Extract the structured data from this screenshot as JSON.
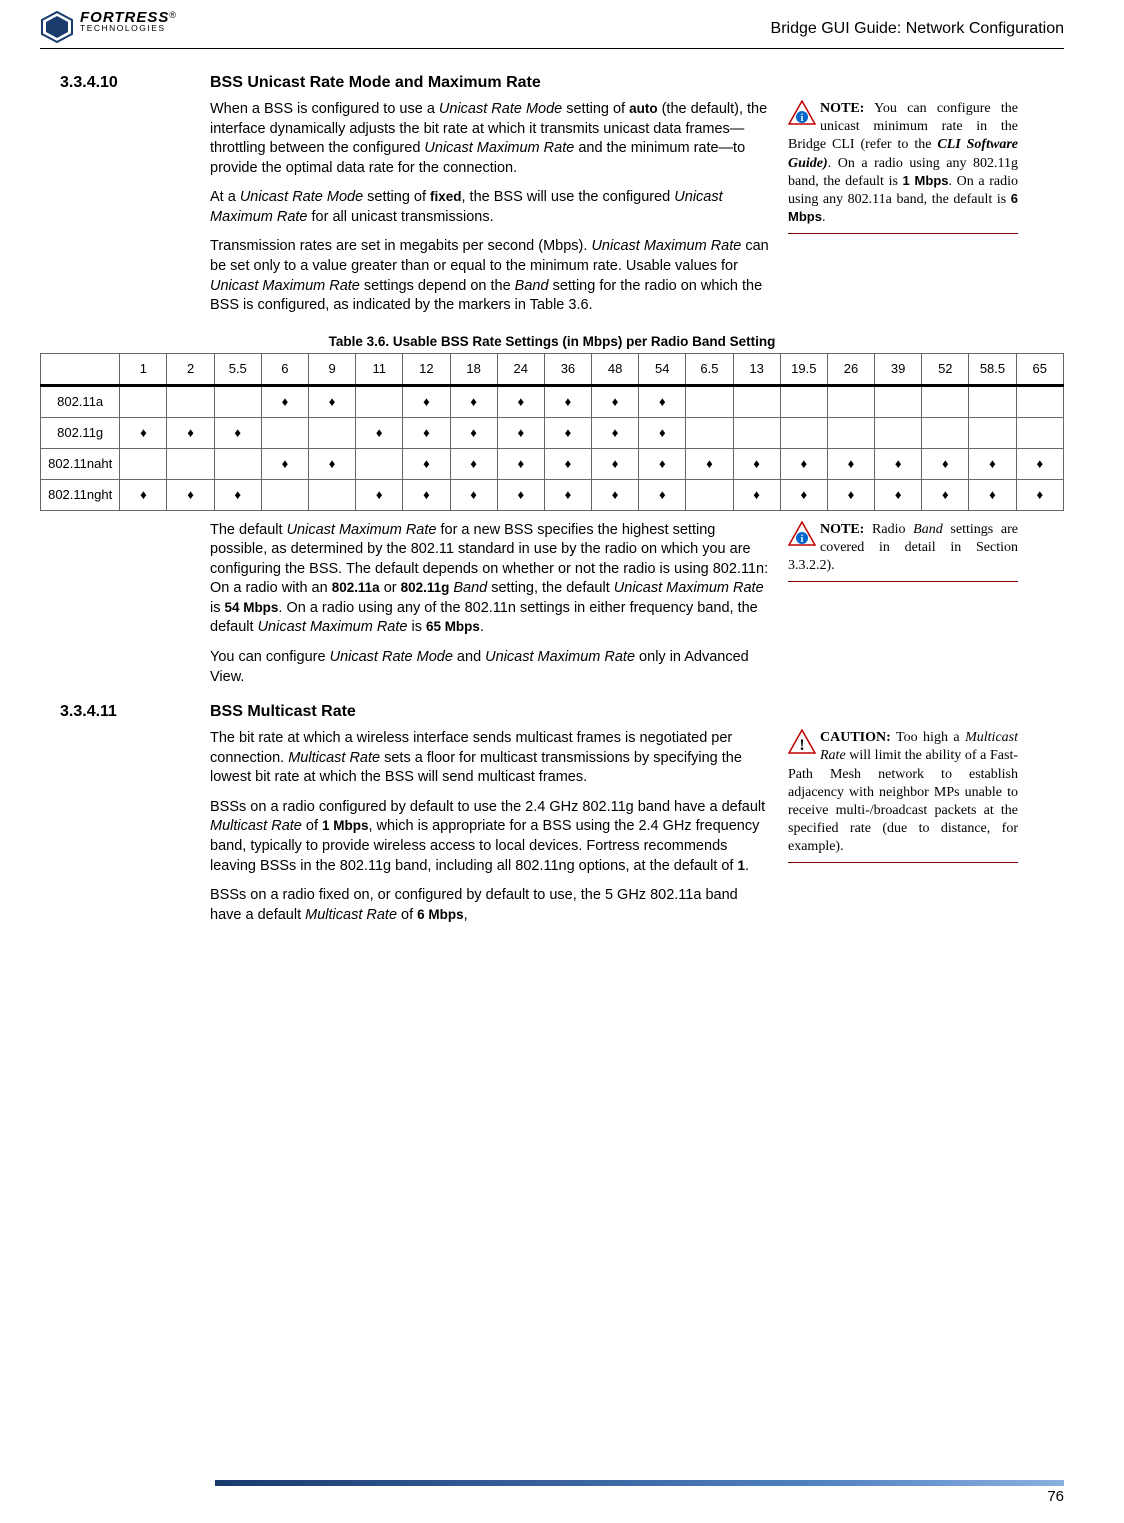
{
  "header": {
    "logo_brand": "FORTRESS",
    "logo_sub": "TECHNOLOGIES",
    "logo_r": "®",
    "guide_title": "Bridge GUI Guide: Network Configuration"
  },
  "sec10": {
    "num": "3.3.4.10",
    "heading": "BSS Unicast Rate Mode and Maximum Rate",
    "p1_a": "When a BSS is configured to use a ",
    "p1_b": "Unicast Rate Mode",
    "p1_c": " setting of ",
    "p1_d": "auto",
    "p1_e": " (the default), the interface dynamically adjusts the bit rate at which it transmits unicast data frames—throttling between the configured ",
    "p1_f": "Unicast Maximum Rate",
    "p1_g": " and the minimum rate—to provide the optimal data rate for the connection.",
    "p2_a": "At a ",
    "p2_b": "Unicast Rate Mode",
    "p2_c": " setting of ",
    "p2_d": "fixed",
    "p2_e": ", the BSS will use the configured ",
    "p2_f": "Unicast Maximum Rate",
    "p2_g": " for all unicast transmissions.",
    "p3_a": "Transmission rates are set in megabits per second (Mbps). ",
    "p3_b": "Unicast Maximum Rate",
    "p3_c": " can be set only to a value greater than or equal to the minimum rate. Usable values for ",
    "p3_d": "Unicast Maximum Rate",
    "p3_e": " settings depend on the ",
    "p3_f": "Band",
    "p3_g": " setting for the radio on which the BSS is configured, as indicated by the markers in Table 3.6.",
    "note_label": "NOTE:",
    "note_a": " You can configure the unicast minimum rate in the Bridge CLI (refer to the ",
    "note_b": "CLI Software Guide)",
    "note_c": ". On a radio using any 802.11g band, the default is ",
    "note_d": "1 Mbps",
    "note_e": ". On a radio using any 802.11a band, the default is ",
    "note_f": "6 Mbps",
    "note_g": "."
  },
  "table": {
    "caption": "Table 3.6. Usable BSS Rate Settings (in Mbps) per Radio Band Setting",
    "headers": [
      "",
      "1",
      "2",
      "5.5",
      "6",
      "9",
      "11",
      "12",
      "18",
      "24",
      "36",
      "48",
      "54",
      "6.5",
      "13",
      "19.5",
      "26",
      "39",
      "52",
      "58.5",
      "65"
    ],
    "rows": [
      {
        "band": "802.11a",
        "marks": [
          0,
          0,
          0,
          1,
          1,
          0,
          1,
          1,
          1,
          1,
          1,
          1,
          0,
          0,
          0,
          0,
          0,
          0,
          0,
          0
        ]
      },
      {
        "band": "802.11g",
        "marks": [
          1,
          1,
          1,
          0,
          0,
          1,
          1,
          1,
          1,
          1,
          1,
          1,
          0,
          0,
          0,
          0,
          0,
          0,
          0,
          0
        ]
      },
      {
        "band": "802.11naht",
        "marks": [
          0,
          0,
          0,
          1,
          1,
          0,
          1,
          1,
          1,
          1,
          1,
          1,
          1,
          1,
          1,
          1,
          1,
          1,
          1,
          1
        ]
      },
      {
        "band": "802.11nght",
        "marks": [
          1,
          1,
          1,
          0,
          0,
          1,
          1,
          1,
          1,
          1,
          1,
          1,
          0,
          1,
          1,
          1,
          1,
          1,
          1,
          1
        ]
      }
    ]
  },
  "after_table": {
    "p1_a": "The default ",
    "p1_b": "Unicast Maximum Rate",
    "p1_c": " for a new BSS specifies the highest setting possible, as determined by the 802.11 standard in use by the radio on which you are configuring the BSS. The default depends on whether or not the radio is using 802.11n: On a radio with an ",
    "p1_d": "802.11a",
    "p1_e": " or ",
    "p1_f": "802.11g",
    "p1_g": " ",
    "p1_h": "Band",
    "p1_i": " setting, the default ",
    "p1_j": "Unicast Maximum Rate",
    "p1_k": " is ",
    "p1_l": "54 Mbps",
    "p1_m": ". On a radio using any of the 802.11n settings in either frequency band, the default ",
    "p1_n": "Unicast Maximum Rate",
    "p1_o": " is ",
    "p1_p": "65 Mbps",
    "p1_q": ".",
    "p2_a": "You can configure ",
    "p2_b": "Unicast Rate Mode",
    "p2_c": " and ",
    "p2_d": "Unicast Maximum Rate",
    "p2_e": " only in Advanced View.",
    "note_label": "NOTE:",
    "note_a": " Radio ",
    "note_b": "Band",
    "note_c": " settings are covered in detail in Section 3.3.2.2)."
  },
  "sec11": {
    "num": "3.3.4.11",
    "heading": "BSS Multicast Rate",
    "p1_a": "The bit rate at which a wireless interface sends multicast frames is negotiated per connection. ",
    "p1_b": "Multicast Rate",
    "p1_c": " sets a floor for multicast transmissions by specifying the lowest bit rate at which the BSS will send multicast frames.",
    "p2_a": "BSSs on a radio configured by default to use the 2.4 GHz 802.11g band have a default ",
    "p2_b": "Multicast Rate",
    "p2_c": " of ",
    "p2_d": "1 Mbps",
    "p2_e": ", which is appropriate for a BSS using the 2.4 GHz frequency band, typically to provide wireless access to local devices. Fortress recommends leaving BSSs in the 802.11g band, including all 802.11ng options, at the default of ",
    "p2_f": "1",
    "p2_g": ".",
    "p3_a": "BSSs on a radio fixed on, or configured by default to use, the 5 GHz 802.11a band have a default ",
    "p3_b": "Multicast Rate",
    "p3_c": " of ",
    "p3_d": "6 Mbps",
    "p3_e": ",",
    "caution_label": "CAUTION:",
    "caution_a": " Too high a ",
    "caution_b": "Multicast Rate",
    "caution_c": " will limit the ability of a Fast-Path Mesh network to establish adjacency with neighbor MPs unable to receive multi-/broadcast packets at the specified rate (due to distance, for example)."
  },
  "page_number": "76"
}
